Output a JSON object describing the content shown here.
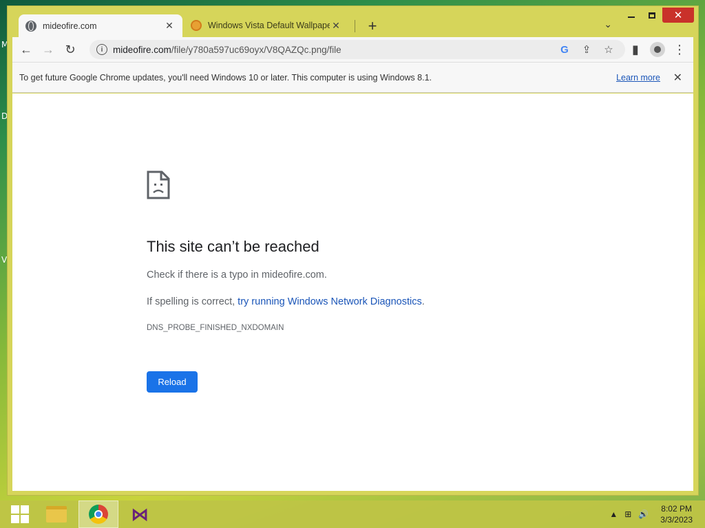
{
  "desktop": {
    "edge_letters": [
      "M",
      "D",
      "V"
    ]
  },
  "window": {
    "minimize": "–",
    "maximize": "□",
    "close": "✕"
  },
  "tabs": [
    {
      "title": "mideofire.com",
      "close": "✕",
      "active": true
    },
    {
      "title": "Windows Vista Default Wallpaper",
      "close": "✕",
      "active": false
    }
  ],
  "new_tab": "+",
  "tab_search": "⌄",
  "toolbar": {
    "back": "←",
    "forward": "→",
    "reload": "↻",
    "url_host": "mideofire.com",
    "url_path": "/file/y780a597uc69oyx/V8QAZQc.png/file",
    "google_lens": "G",
    "share": "⇪",
    "bookmark": "☆",
    "side_panel": "▮",
    "menu": "⋮"
  },
  "infobar": {
    "message": "To get future Google Chrome updates, you'll need Windows 10 or later. This computer is using Windows 8.1.",
    "link": "Learn more",
    "close": "✕"
  },
  "error_page": {
    "title": "This site can’t be reached",
    "line1": "Check if there is a typo in mideofire.com.",
    "line2_prefix": "If spelling is correct, ",
    "line2_link": "try running Windows Network Diagnostics",
    "line2_suffix": ".",
    "code": "DNS_PROBE_FINISHED_NXDOMAIN",
    "reload_label": "Reload"
  },
  "taskbar": {
    "apps": [
      "start",
      "file-explorer",
      "google-chrome",
      "visual-studio"
    ],
    "tray": {
      "up_arrow": "▲",
      "network": "⊞",
      "volume": "🔊"
    },
    "time": "8:02 PM",
    "date": "3/3/2023"
  }
}
